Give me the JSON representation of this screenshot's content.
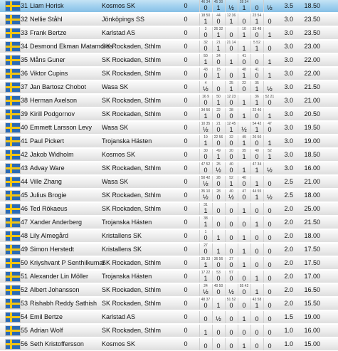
{
  "rows": [
    {
      "rank": "31",
      "name": "Liam Horisk",
      "club": "Kosmos SK",
      "a": "0",
      "opp": [
        "46 34",
        "45 30",
        "",
        "28 34",
        "",
        ""
      ],
      "res": [
        "0",
        "1",
        "½",
        "1",
        "0",
        "½"
      ],
      "points": "3.5",
      "tiebreak": "18.50",
      "highlighted": true
    },
    {
      "rank": "32",
      "name": "Nellie Ståhl",
      "club": "Jönköpings SS",
      "a": "0",
      "opp": [
        "18 50",
        "44",
        "12 36",
        "",
        "23 54",
        ""
      ],
      "res": [
        "1",
        "0",
        "1",
        "0",
        "1",
        "0"
      ],
      "points": "3.0",
      "tiebreak": "23.50",
      "highlighted": false
    },
    {
      "rank": "33",
      "name": "Frank Bertze",
      "club": "Karlstad AS",
      "a": "0",
      "opp": [
        "3",
        "26 32",
        "",
        "10",
        "33 48",
        ""
      ],
      "res": [
        "0",
        "1",
        "0",
        "1",
        "0",
        "1"
      ],
      "points": "3.0",
      "tiebreak": "23.50",
      "highlighted": false
    },
    {
      "rank": "34",
      "name": "Desmond Ekman Matamoros",
      "club": "SK Rockaden, Sthlm",
      "a": "0",
      "opp": [
        "32",
        "21",
        "21 14",
        "",
        "5 52",
        ""
      ],
      "res": [
        "0",
        "1",
        "0",
        "1",
        "1",
        "0"
      ],
      "points": "3.0",
      "tiebreak": "23.00",
      "highlighted": false
    },
    {
      "rank": "35",
      "name": "Måns Guner",
      "club": "SK Rockaden, Sthlm",
      "a": "0",
      "opp": [
        "50",
        "24",
        "",
        "41",
        "",
        ""
      ],
      "res": [
        "1",
        "0",
        "1",
        "0",
        "0",
        "1"
      ],
      "points": "3.0",
      "tiebreak": "22.00",
      "highlighted": false
    },
    {
      "rank": "36",
      "name": "Viktor Cupins",
      "club": "SK Rockaden, Sthlm",
      "a": "0",
      "opp": [
        "43",
        "15",
        "",
        "48",
        "41",
        ""
      ],
      "res": [
        "0",
        "1",
        "0",
        "1",
        "0",
        "1"
      ],
      "points": "3.0",
      "tiebreak": "22.00",
      "highlighted": false
    },
    {
      "rank": "37",
      "name": "Jan Bartosz Chobot",
      "club": "Wasa SK",
      "a": "0",
      "opp": [
        "4",
        "",
        "25",
        "22",
        "35",
        ""
      ],
      "res": [
        "½",
        "0",
        "1",
        "0",
        "1",
        "½"
      ],
      "points": "3.0",
      "tiebreak": "21.50",
      "highlighted": false
    },
    {
      "rank": "38",
      "name": "Herman Axelson",
      "club": "SK Rockaden, Sthlm",
      "a": "0",
      "opp": [
        "16 9",
        "50",
        "12 23",
        "",
        "36",
        "52 21"
      ],
      "res": [
        "0",
        "1",
        "0",
        "1",
        "1",
        "0"
      ],
      "points": "3.0",
      "tiebreak": "21.00",
      "highlighted": false
    },
    {
      "rank": "39",
      "name": "Kirill Podgornov",
      "club": "SK Rockaden, Sthlm",
      "a": "0",
      "opp": [
        "34 56",
        "22",
        "28",
        "",
        "22 46",
        ""
      ],
      "res": [
        "1",
        "0",
        "0",
        "1",
        "0",
        "1"
      ],
      "points": "3.0",
      "tiebreak": "20.50",
      "highlighted": false
    },
    {
      "rank": "40",
      "name": "Emmett Larsson Levy",
      "club": "Wasa SK",
      "a": "0",
      "opp": [
        "10 35",
        "21",
        "12 45",
        "",
        "54 42",
        "47"
      ],
      "res": [
        "½",
        "0",
        "1",
        "½",
        "1",
        "0"
      ],
      "points": "3.0",
      "tiebreak": "19.50",
      "highlighted": false
    },
    {
      "rank": "41",
      "name": "Paul Pickert",
      "club": "Trojanska Hästen",
      "a": "0",
      "opp": [
        "19",
        "22 56",
        "32",
        "49",
        "26 50",
        ""
      ],
      "res": [
        "1",
        "0",
        "0",
        "1",
        "0",
        "1"
      ],
      "points": "3.0",
      "tiebreak": "19.00",
      "highlighted": false
    },
    {
      "rank": "42",
      "name": "Jakob Widholm",
      "club": "Kosmos SK",
      "a": "0",
      "opp": [
        "30",
        "49",
        "20",
        "35",
        "40",
        "52"
      ],
      "res": [
        "0",
        "1",
        "0",
        "1",
        "0",
        "1"
      ],
      "points": "3.0",
      "tiebreak": "18.50",
      "highlighted": false
    },
    {
      "rank": "43",
      "name": "Advay Ware",
      "club": "SK Rockaden, Sthlm",
      "a": "0",
      "opp": [
        "47 52",
        "25",
        "40",
        "",
        "47 34",
        ""
      ],
      "res": [
        "0",
        "½",
        "0",
        "1",
        "1",
        "½"
      ],
      "points": "3.0",
      "tiebreak": "16.00",
      "highlighted": false
    },
    {
      "rank": "44",
      "name": "Ville Zhang",
      "club": "Wasa SK",
      "a": "0",
      "opp": [
        "50 42",
        "28",
        "52",
        "40",
        "",
        ""
      ],
      "res": [
        "½",
        "0",
        "1",
        "0",
        "1",
        "0"
      ],
      "points": "2.5",
      "tiebreak": "21.00",
      "highlighted": false
    },
    {
      "rank": "45",
      "name": "Julius Brogie",
      "club": "SK Rockaden, Sthlm",
      "a": "0",
      "opp": [
        "35 10",
        "28",
        "40",
        "47",
        "44 55",
        ""
      ],
      "res": [
        "½",
        "0",
        "½",
        "0",
        "1",
        "½"
      ],
      "points": "2.5",
      "tiebreak": "18.00",
      "highlighted": false
    },
    {
      "rank": "46",
      "name": "Ted Rökaeus",
      "club": "SK Rockaden, Sthlm",
      "a": "0",
      "opp": [
        "31",
        "",
        "",
        "",
        "",
        ""
      ],
      "res": [
        "1",
        "0",
        "0",
        "1",
        "0",
        "0"
      ],
      "points": "2.0",
      "tiebreak": "25.00",
      "highlighted": false
    },
    {
      "rank": "47",
      "name": "Xander Anderberg",
      "club": "Trojanska Hästen",
      "a": "0",
      "opp": [
        "38",
        "",
        "",
        "",
        "",
        ""
      ],
      "res": [
        "1",
        "0",
        "0",
        "0",
        "1",
        "0"
      ],
      "points": "2.0",
      "tiebreak": "21.50",
      "highlighted": false
    },
    {
      "rank": "48",
      "name": "Lily Almegård",
      "club": "Kristallens SK",
      "a": "0",
      "opp": [
        "1",
        "",
        "",
        "",
        "",
        ""
      ],
      "res": [
        "0",
        "1",
        "0",
        "1",
        "0",
        "0"
      ],
      "points": "2.0",
      "tiebreak": "18.00",
      "highlighted": false
    },
    {
      "rank": "49",
      "name": "Simon Herstedt",
      "club": "Kristallens SK",
      "a": "0",
      "opp": [
        "27",
        "",
        "",
        "",
        "",
        ""
      ],
      "res": [
        "0",
        "1",
        "0",
        "1",
        "0",
        "0"
      ],
      "points": "2.0",
      "tiebreak": "17.50",
      "highlighted": false
    },
    {
      "rank": "50",
      "name": "Kriyshvant P Senthilkumar",
      "club": "SK Rockaden, Sthlm",
      "a": "0",
      "opp": [
        "35 33",
        "36 56",
        "27",
        "",
        "",
        ""
      ],
      "res": [
        "1",
        "0",
        "0",
        "1",
        "0",
        "0"
      ],
      "points": "2.0",
      "tiebreak": "17.50",
      "highlighted": false
    },
    {
      "rank": "51",
      "name": "Alexander Lin Möller",
      "club": "Trojanska Hästen",
      "a": "0",
      "opp": [
        "17 22",
        "53",
        "57",
        "",
        "",
        ""
      ],
      "res": [
        "1",
        "0",
        "0",
        "0",
        "1",
        "0"
      ],
      "points": "2.0",
      "tiebreak": "17.00",
      "highlighted": false
    },
    {
      "rank": "52",
      "name": "Albert Johansson",
      "club": "SK Rockaden, Sthlm",
      "a": "0",
      "opp": [
        "24",
        "40 50",
        "",
        "55 42",
        "",
        ""
      ],
      "res": [
        "½",
        "0",
        "½",
        "0",
        "1",
        "0"
      ],
      "points": "2.0",
      "tiebreak": "16.50",
      "highlighted": false
    },
    {
      "rank": "53",
      "name": "Rishabh Reddy Sathish",
      "club": "SK Rockaden, Sthlm",
      "a": "0",
      "opp": [
        "48 37",
        "",
        "51 52",
        "",
        "43 58",
        ""
      ],
      "res": [
        "0",
        "1",
        "0",
        "0",
        "1",
        "0"
      ],
      "points": "2.0",
      "tiebreak": "15.50",
      "highlighted": false
    },
    {
      "rank": "54",
      "name": "Emil Bertze",
      "club": "Karlstad AS",
      "a": "0",
      "opp": [
        "",
        "",
        "",
        "",
        "",
        ""
      ],
      "res": [
        "0",
        "½",
        "0",
        "1",
        "0",
        "0"
      ],
      "points": "1.5",
      "tiebreak": "19.00",
      "highlighted": false
    },
    {
      "rank": "55",
      "name": "Adrian Wolf",
      "club": "SK Rockaden, Sthlm",
      "a": "0",
      "opp": [
        "",
        "",
        "",
        "",
        "",
        ""
      ],
      "res": [
        "1",
        "0",
        "0",
        "0",
        "0",
        "0"
      ],
      "points": "1.0",
      "tiebreak": "16.00",
      "highlighted": false
    },
    {
      "rank": "56",
      "name": "Seth Kristoffersson",
      "club": "Kosmos SK",
      "a": "0",
      "opp": [
        "",
        "",
        "",
        "",
        "",
        ""
      ],
      "res": [
        "0",
        "0",
        "0",
        "1",
        "0",
        "0"
      ],
      "points": "1.0",
      "tiebreak": "15.00",
      "highlighted": false
    }
  ],
  "colors": {
    "row_highlight": "#9fcfee",
    "row_default": "#ececec",
    "flag_blue": "#2a6ab5",
    "flag_yellow": "#f3c512"
  },
  "icons": {
    "flag": "sweden-flag-icon"
  }
}
